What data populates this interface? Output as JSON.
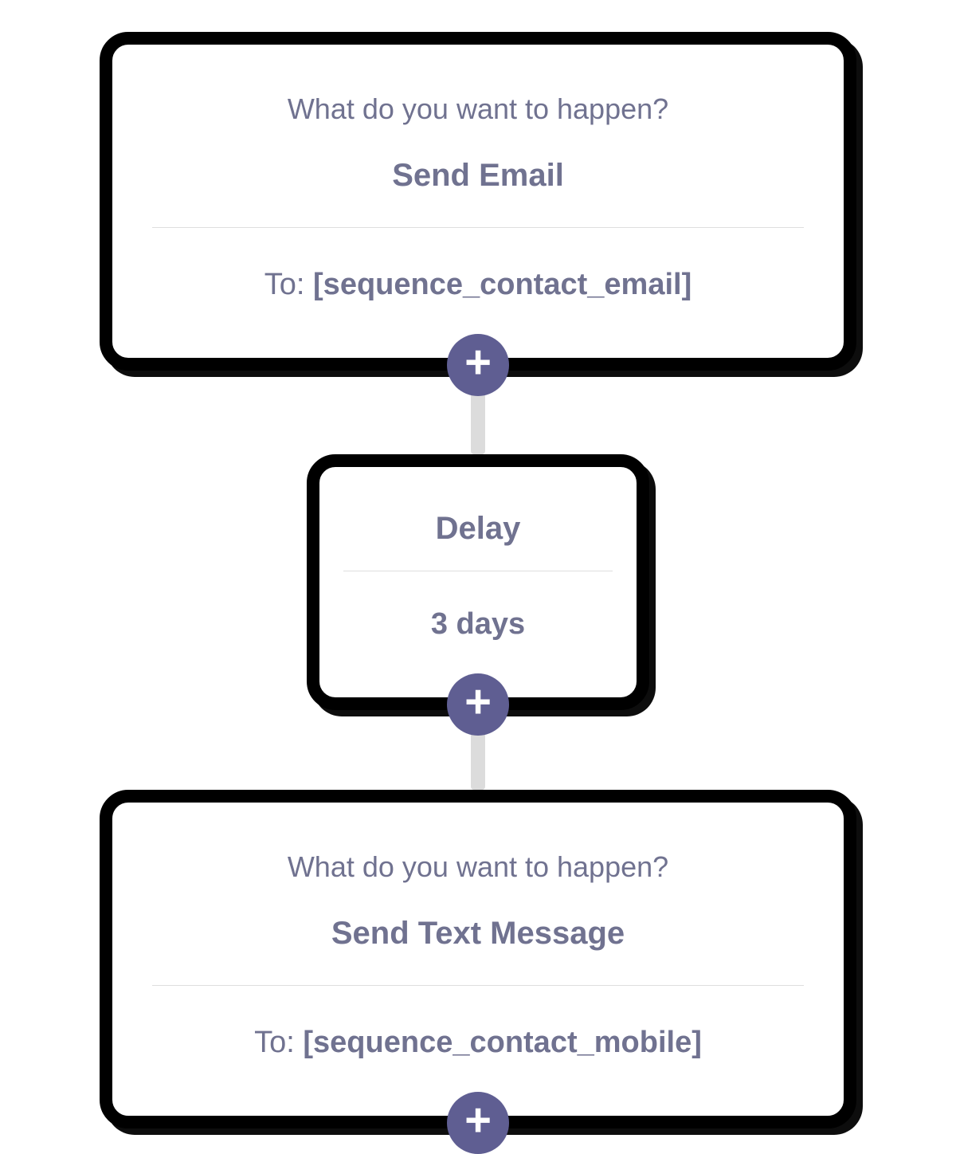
{
  "steps": [
    {
      "prompt": "What do you want to happen?",
      "title": "Send Email",
      "to_prefix": "To: ",
      "to_value": "[sequence_contact_email]",
      "add_glyph": "+"
    },
    {
      "title": "Delay",
      "value": "3 days",
      "add_glyph": "+"
    },
    {
      "prompt": "What do you want to happen?",
      "title": "Send Text Message",
      "to_prefix": "To: ",
      "to_value": "[sequence_contact_mobile]",
      "add_glyph": "+"
    }
  ]
}
